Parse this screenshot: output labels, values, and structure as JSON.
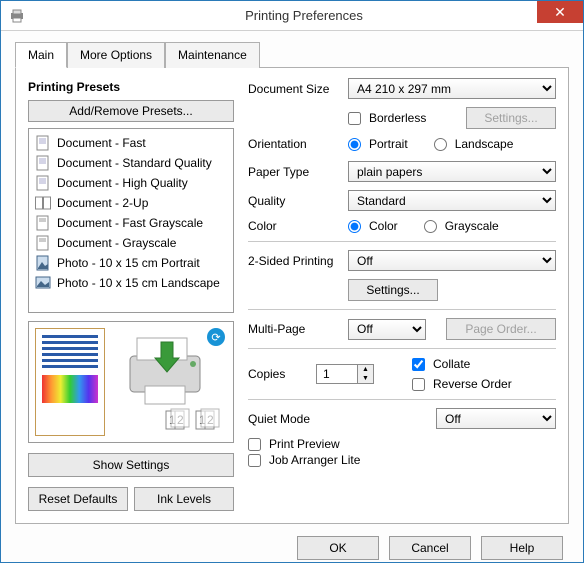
{
  "window": {
    "title": "Printing Preferences",
    "close": "✕"
  },
  "tabs": {
    "main": "Main",
    "more": "More Options",
    "maint": "Maintenance"
  },
  "presets": {
    "heading": "Printing Presets",
    "addRemove": "Add/Remove Presets...",
    "items": [
      "Document - Fast",
      "Document - Standard Quality",
      "Document - High Quality",
      "Document - 2-Up",
      "Document - Fast Grayscale",
      "Document - Grayscale",
      "Photo - 10 x 15 cm Portrait",
      "Photo - 10 x 15 cm Landscape"
    ]
  },
  "buttons": {
    "showSettings": "Show Settings",
    "resetDefaults": "Reset Defaults",
    "inkLevels": "Ink Levels",
    "settings": "Settings...",
    "settingsDisabled": "Settings...",
    "pageOrder": "Page Order...",
    "ok": "OK",
    "cancel": "Cancel",
    "help": "Help"
  },
  "form": {
    "docSizeLabel": "Document Size",
    "docSize": "A4 210 x 297 mm",
    "borderless": "Borderless",
    "orientationLabel": "Orientation",
    "portrait": "Portrait",
    "landscape": "Landscape",
    "paperTypeLabel": "Paper Type",
    "paperType": "plain papers",
    "qualityLabel": "Quality",
    "quality": "Standard",
    "colorLabel": "Color",
    "colorOpt": "Color",
    "grayOpt": "Grayscale",
    "duplexLabel": "2-Sided Printing",
    "duplex": "Off",
    "multiPageLabel": "Multi-Page",
    "multiPage": "Off",
    "copiesLabel": "Copies",
    "copies": "1",
    "collate": "Collate",
    "reverse": "Reverse Order",
    "quietLabel": "Quiet Mode",
    "quiet": "Off",
    "printPreview": "Print Preview",
    "jobArranger": "Job Arranger Lite"
  }
}
